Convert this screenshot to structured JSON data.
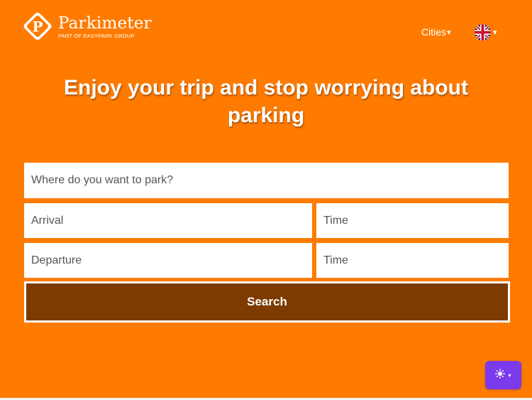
{
  "header": {
    "brand_name": "Parkimeter",
    "brand_subtitle": "PART OF EASYPARK GROUP",
    "nav_cities": "Cities",
    "nav_cities_caret": "▾",
    "language_icon": "uk-flag-icon",
    "language_caret": "▾"
  },
  "hero": {
    "title": "Enjoy your trip and stop worrying about parking"
  },
  "search_form": {
    "where_placeholder": "Where do you want to park?",
    "arrival_placeholder": "Arrival",
    "arrival_time_placeholder": "Time",
    "departure_placeholder": "Departure",
    "departure_time_placeholder": "Time",
    "search_label": "Search"
  },
  "theme_toggle": {
    "icon": "sun-icon",
    "caret": "▾"
  },
  "colors": {
    "background": "#ff7b00",
    "search_button": "#7d3b00",
    "theme_toggle": "#7c3aed"
  }
}
